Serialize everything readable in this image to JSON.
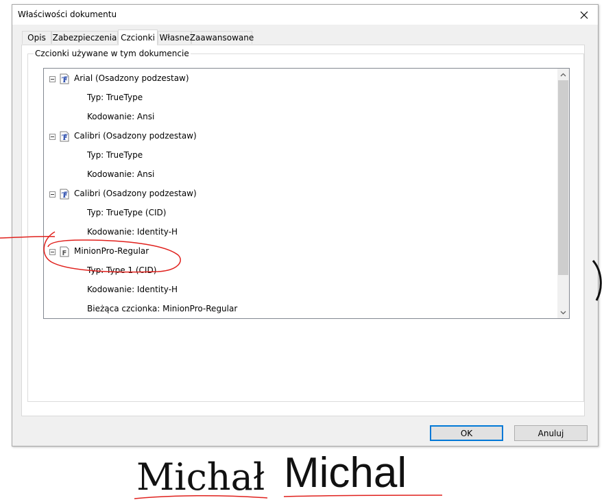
{
  "dialog": {
    "title": "Właściwości dokumentu",
    "close_icon": "close-icon"
  },
  "tabs": [
    {
      "label": "Opis",
      "active": false
    },
    {
      "label": "Zabezpieczenia",
      "active": false
    },
    {
      "label": "Czcionki",
      "active": true
    },
    {
      "label": "Własne",
      "active": false
    },
    {
      "label": "Zaawansowane",
      "active": false
    }
  ],
  "fonts_group": {
    "legend": "Czcionki używane w tym dokumencie",
    "tree": [
      {
        "name": "Arial (Osadzony podzestaw)",
        "icon": "truetype-font-icon",
        "type": "Typ: TrueType",
        "encoding": "Kodowanie: Ansi"
      },
      {
        "name": "Calibri (Osadzony podzestaw)",
        "icon": "truetype-font-icon",
        "type": "Typ: TrueType",
        "encoding": "Kodowanie: Ansi"
      },
      {
        "name": "Calibri (Osadzony podzestaw)",
        "icon": "truetype-font-icon",
        "type": "Typ: TrueType (CID)",
        "encoding": "Kodowanie: Identity-H"
      },
      {
        "name": "MinionPro-Regular",
        "icon": "type1-font-icon",
        "type": "Typ: Type 1 (CID)",
        "encoding": "Kodowanie: Identity-H",
        "current": "Bieżąca czcionka: MinionPro-Regular"
      }
    ]
  },
  "buttons": {
    "ok": "OK",
    "cancel": "Anuluj"
  },
  "handwritten_samples": {
    "serif": "Michał",
    "sans": "Michal"
  },
  "colors": {
    "default_button_border": "#0078d7",
    "annotation": "#e0201c"
  }
}
